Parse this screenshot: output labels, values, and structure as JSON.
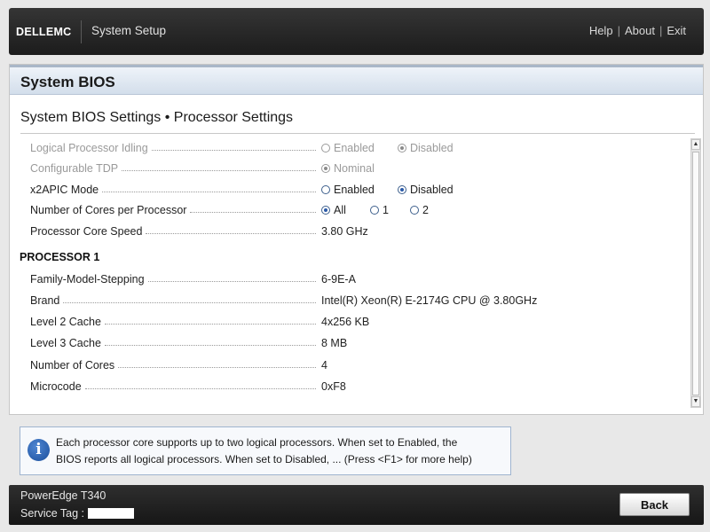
{
  "header": {
    "brand": "DELLEMC",
    "app_title": "System Setup",
    "links": {
      "help": "Help",
      "about": "About",
      "exit": "Exit",
      "separator": "|"
    }
  },
  "section_title": "System BIOS",
  "page_title": "System BIOS Settings • Processor Settings",
  "settings": {
    "logical_processor_idling": {
      "label": "Logical Processor Idling",
      "enabled": false,
      "options": [
        "Enabled",
        "Disabled"
      ],
      "selected": "Disabled"
    },
    "configurable_tdp": {
      "label": "Configurable TDP",
      "enabled": false,
      "options": [
        "Nominal"
      ],
      "selected": "Nominal"
    },
    "x2apic_mode": {
      "label": "x2APIC Mode",
      "enabled": true,
      "options": [
        "Enabled",
        "Disabled"
      ],
      "selected": "Disabled"
    },
    "cores_per_processor": {
      "label": "Number of Cores per Processor",
      "enabled": true,
      "options": [
        "All",
        "1",
        "2"
      ],
      "selected": "All"
    },
    "processor_core_speed": {
      "label": "Processor Core Speed",
      "value": "3.80 GHz"
    }
  },
  "processor1": {
    "heading": "PROCESSOR 1",
    "family_model_stepping": {
      "label": "Family-Model-Stepping",
      "value": "6-9E-A"
    },
    "brand": {
      "label": "Brand",
      "value": "Intel(R) Xeon(R) E-2174G CPU @ 3.80GHz"
    },
    "l2_cache": {
      "label": "Level 2 Cache",
      "value": "4x256 KB"
    },
    "l3_cache": {
      "label": "Level 3 Cache",
      "value": "8 MB"
    },
    "num_cores": {
      "label": "Number of Cores",
      "value": "4"
    },
    "microcode": {
      "label": "Microcode",
      "value": "0xF8"
    }
  },
  "help": {
    "line1": "Each processor core supports up to two logical processors. When set to Enabled, the",
    "line2": "BIOS reports all logical processors. When set to Disabled, ... (Press <F1> for more help)"
  },
  "footer": {
    "model": "PowerEdge T340",
    "service_tag_label": "Service Tag :",
    "back_label": "Back"
  },
  "colors": {
    "topbar": "#1c1c1c",
    "header_band": "#d3deeb",
    "radio_selected": "#2b5aa8",
    "disabled_text": "#9a9a9a"
  }
}
